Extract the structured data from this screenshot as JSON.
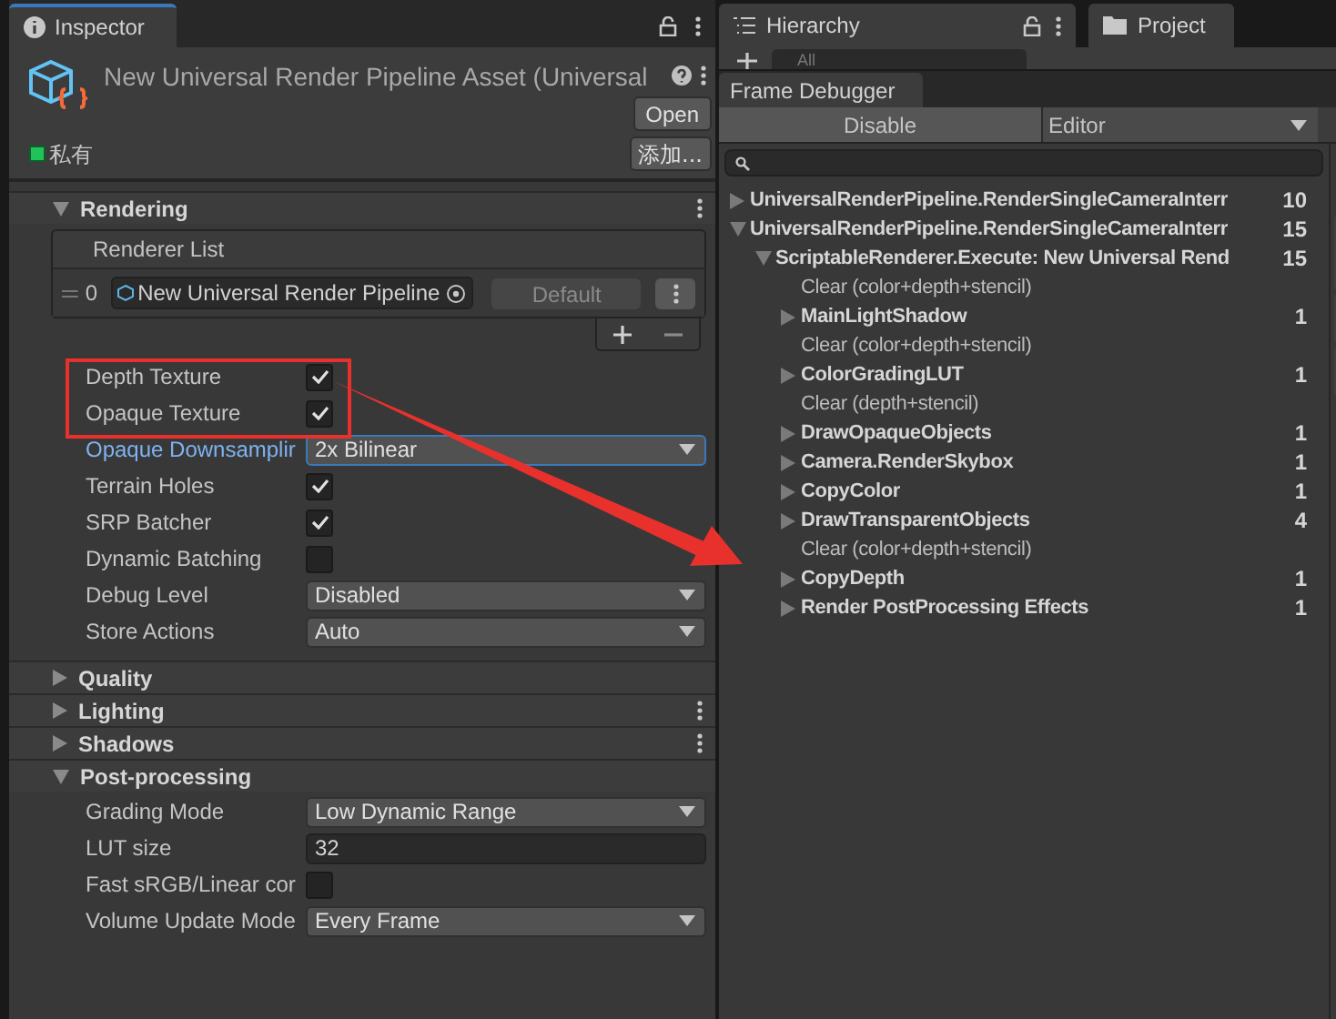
{
  "inspector": {
    "tab": "Inspector",
    "asset_title": "New Universal Render Pipeline Asset (Universal",
    "open_button": "Open",
    "private_toggle": {
      "label": "私有",
      "checked": true
    },
    "add_button": "添加...",
    "sections": [
      {
        "title": "Rendering",
        "expanded": true,
        "menu": true,
        "renderer_list": {
          "header": "Renderer List",
          "items": [
            {
              "index": "0",
              "value": "New Universal Render Pipeline",
              "button": "Default"
            }
          ]
        },
        "properties": [
          {
            "kind": "checkbox",
            "label": "Depth Texture",
            "checked": true,
            "focused": false
          },
          {
            "kind": "checkbox",
            "label": "Opaque Texture",
            "checked": true,
            "focused": false
          },
          {
            "kind": "dropdown",
            "label": "Opaque Downsamplir",
            "value": "2x Bilinear",
            "focused": true
          },
          {
            "kind": "checkbox",
            "label": "Terrain Holes",
            "checked": true,
            "focused": false
          },
          {
            "kind": "checkbox",
            "label": "SRP Batcher",
            "checked": true,
            "focused": false
          },
          {
            "kind": "checkbox",
            "label": "Dynamic Batching",
            "checked": false,
            "focused": false
          },
          {
            "kind": "dropdown",
            "label": "Debug Level",
            "value": "Disabled",
            "focused": false
          },
          {
            "kind": "dropdown",
            "label": "Store Actions",
            "value": "Auto",
            "focused": false
          }
        ]
      },
      {
        "title": "Quality",
        "expanded": false,
        "menu": false
      },
      {
        "title": "Lighting",
        "expanded": false,
        "menu": true
      },
      {
        "title": "Shadows",
        "expanded": false,
        "menu": true
      },
      {
        "title": "Post-processing",
        "expanded": true,
        "menu": false,
        "properties": [
          {
            "kind": "dropdown",
            "label": "Grading Mode",
            "value": "Low Dynamic Range",
            "focused": false
          },
          {
            "kind": "text",
            "label": "LUT size",
            "value": "32",
            "focused": false
          },
          {
            "kind": "checkbox",
            "label": "Fast sRGB/Linear cor",
            "checked": false,
            "focused": false
          },
          {
            "kind": "dropdown",
            "label": "Volume Update Mode",
            "value": "Every Frame",
            "focused": false
          }
        ]
      }
    ]
  },
  "tabs": [
    {
      "label": "Hierarchy",
      "kind": "hierarchy"
    },
    {
      "label": "Project",
      "kind": "project"
    }
  ],
  "hierarchy_search": {
    "placeholder": "All"
  },
  "frame_debugger": {
    "title": "Frame Debugger",
    "disable_button": "Disable",
    "target_dropdown": "Editor",
    "events": [
      {
        "label": "UniversalRenderPipeline.RenderSingleCameraInterr",
        "count": "10",
        "expanded": false
      },
      {
        "label": "UniversalRenderPipeline.RenderSingleCameraInterr",
        "count": "15",
        "expanded": true,
        "children": [
          {
            "label": "ScriptableRenderer.Execute: New Universal Rend",
            "count": "15",
            "expanded": true,
            "children": [
              {
                "label": "Clear (color+depth+stencil)",
                "kind": "leaf"
              },
              {
                "label": "MainLightShadow",
                "count": "1",
                "expanded": false
              },
              {
                "label": "Clear (color+depth+stencil)",
                "kind": "leaf"
              },
              {
                "label": "ColorGradingLUT",
                "count": "1",
                "expanded": false
              },
              {
                "label": "Clear (depth+stencil)",
                "kind": "leaf"
              },
              {
                "label": "DrawOpaqueObjects",
                "count": "1",
                "expanded": false
              },
              {
                "label": "Camera.RenderSkybox",
                "count": "1",
                "expanded": false
              },
              {
                "label": "CopyColor",
                "count": "1",
                "expanded": false
              },
              {
                "label": "DrawTransparentObjects",
                "count": "4",
                "expanded": false
              },
              {
                "label": "Clear (color+depth+stencil)",
                "kind": "leaf"
              },
              {
                "label": "CopyDepth",
                "count": "1",
                "expanded": false
              },
              {
                "label": "Render PostProcessing Effects",
                "count": "1",
                "expanded": false
              }
            ]
          }
        ]
      }
    ]
  },
  "annotation": {
    "highlight": true,
    "arrow": true
  }
}
